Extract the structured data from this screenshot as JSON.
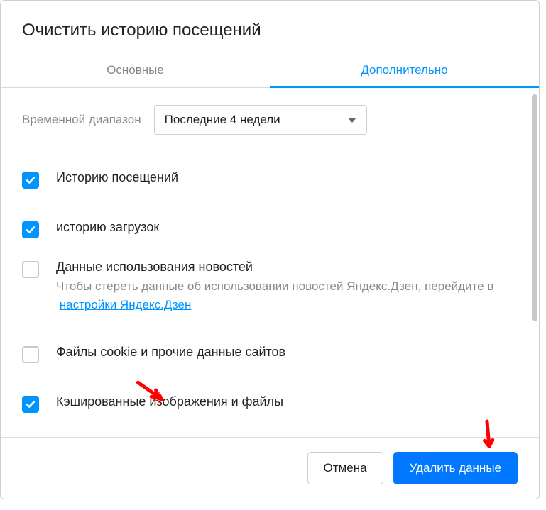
{
  "title": "Очистить историю посещений",
  "tabs": {
    "basic": "Основные",
    "advanced": "Дополнительно"
  },
  "timeRange": {
    "label": "Временной диапазон",
    "selected": "Последние 4 недели"
  },
  "options": {
    "browsingHistory": {
      "label": "Историю посещений",
      "checked": true
    },
    "downloadHistory": {
      "label": "историю загрузок",
      "checked": true
    },
    "newsUsage": {
      "label": "Данные использования новостей",
      "desc_prefix": "Чтобы стереть данные об использовании новостей Яндекс.Дзен, перейдите в ",
      "link": "настройки Яндекс.Дзен",
      "checked": false
    },
    "cookies": {
      "label": "Файлы cookie и прочие данные сайтов",
      "checked": false
    },
    "cache": {
      "label": "Кэшированные изображения и файлы",
      "checked": true
    }
  },
  "buttons": {
    "cancel": "Отмена",
    "delete": "Удалить данные"
  }
}
